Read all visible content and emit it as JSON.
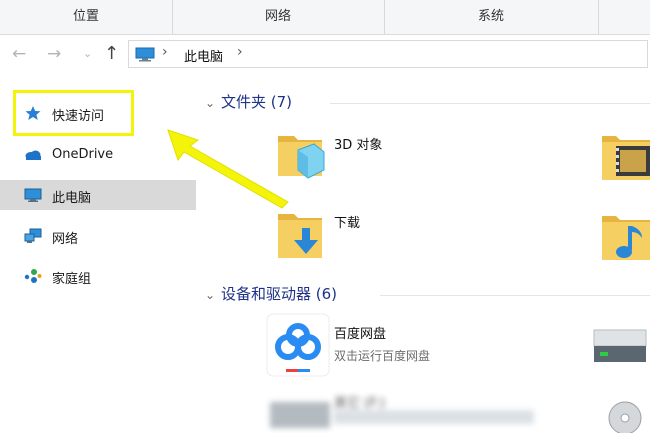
{
  "ribbon": {
    "groups": [
      {
        "label": "位置"
      },
      {
        "label": "网络"
      },
      {
        "label": "系统"
      }
    ]
  },
  "address_bar": {
    "crumbs": [
      "此电脑"
    ]
  },
  "nav_pane": {
    "items": [
      {
        "label": "快速访问",
        "icon": "star-icon"
      },
      {
        "label": "OneDrive",
        "icon": "cloud-icon"
      },
      {
        "label": "此电脑",
        "icon": "monitor-icon",
        "selected": true
      },
      {
        "label": "网络",
        "icon": "network-icon"
      },
      {
        "label": "家庭组",
        "icon": "homegroup-icon"
      }
    ]
  },
  "content": {
    "folders_group": {
      "title": "文件夹 (7)"
    },
    "folders": [
      {
        "name": "3D 对象",
        "icon": "3d-objects-folder-icon"
      },
      {
        "name": "下载",
        "icon": "downloads-folder-icon"
      }
    ],
    "devices_group": {
      "title": "设备和驱动器 (6)"
    },
    "devices": [
      {
        "name": "百度网盘",
        "sub": "双击运行百度网盘",
        "icon": "baidu-netdisk-icon"
      },
      {
        "name": "其它 (F:)",
        "icon": "drive-icon"
      }
    ]
  },
  "colors": {
    "highlight": "#f4f40a",
    "accent": "#1e3287",
    "folder": "#f2c75a",
    "selected_bg": "#d9d9d9"
  }
}
